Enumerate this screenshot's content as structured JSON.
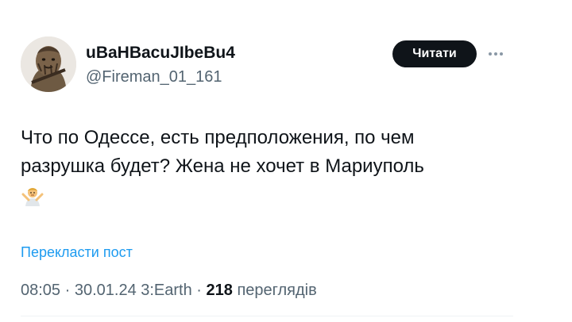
{
  "author": {
    "display_name": "uBaHBacuJIbeBu4",
    "handle": "@Fireman_01_161"
  },
  "actions": {
    "follow_label": "Читати",
    "more_icon": "more-horizontal-icon"
  },
  "tweet": {
    "text_line_1": "Что по Одессе, есть предположения, по чем",
    "text_line_2": "разрушка будет? Жена не хочет в Мариуполь",
    "emoji": "man-shrugging-emoji"
  },
  "translate_label": "Перекласти пост",
  "meta": {
    "time": "08:05",
    "sep1": " · ",
    "date": "30.01.24 3:Earth",
    "sep2": " · ",
    "views_count": "218",
    "views_label": " переглядів"
  },
  "colors": {
    "accent": "#1d9bf0",
    "text": "#0f1419",
    "secondary": "#536471",
    "button_bg": "#0f1419"
  }
}
